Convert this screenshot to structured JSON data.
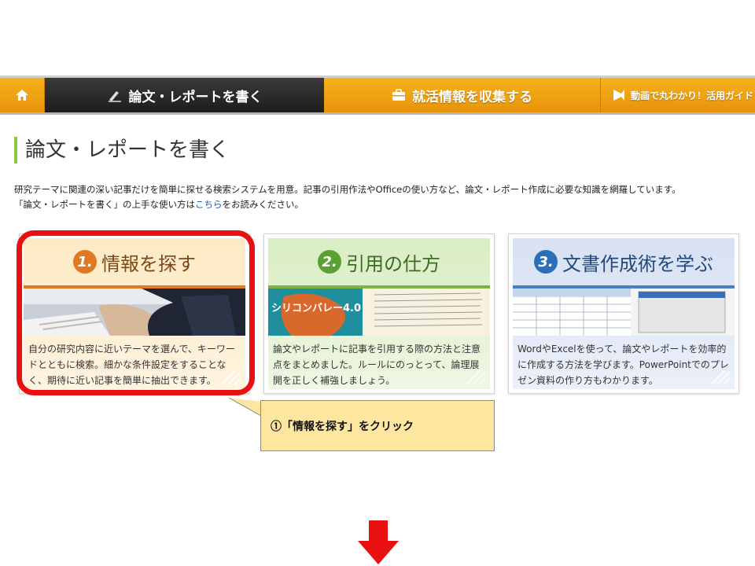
{
  "nav": {
    "home_icon": "home-icon",
    "active_tab": {
      "label": "論文・レポートを書く",
      "icon": "pen-icon"
    },
    "tab_job": {
      "label": "就活情報を収集する",
      "icon": "briefcase-icon"
    },
    "tab_guide": {
      "label": "動画で丸わかり！活用ガイド",
      "icon": "play-icon"
    }
  },
  "page": {
    "title": "論文・レポートを書く",
    "intro_line1": "研究テーマに関連の深い記事だけを簡単に探せる検索システムを用意。記事の引用作法やOfficeの使い方など、論文・レポート作成に必要な知識を網羅しています。",
    "intro_line2_pre": "「論文・レポートを書く」の上手な使い方は",
    "intro_line2_link": "こちら",
    "intro_line2_post": "をお読みください。"
  },
  "cards": [
    {
      "num": "1.",
      "title": "情報を探す",
      "desc": "自分の研究内容に近いテーマを選んで、キーワードとともに検索。細かな条件設定をすることなく、期待に近い記事を簡単に抽出できます。"
    },
    {
      "num": "2.",
      "title": "引用の仕方",
      "image_text_title": "シリコンバレー4.0",
      "desc": "論文やレポートに記事を引用する際の方法と注意点をまとめました。ルールにのっとって、論理展開を正しく補強しましょう。"
    },
    {
      "num": "3.",
      "title": "文書作成術を学ぶ",
      "desc": "WordやExcelを使って、論文やレポートを効率的に作成する方法を学びます。PowerPointでのプレゼン資料の作り方もわかります。"
    }
  ],
  "callout": {
    "text": "①「情報を探す」をクリック"
  },
  "colors": {
    "nav_orange": "#f0a313",
    "highlight_red": "#e81010",
    "callout_fill": "#fde6a0",
    "arrow_red": "#e81010"
  }
}
